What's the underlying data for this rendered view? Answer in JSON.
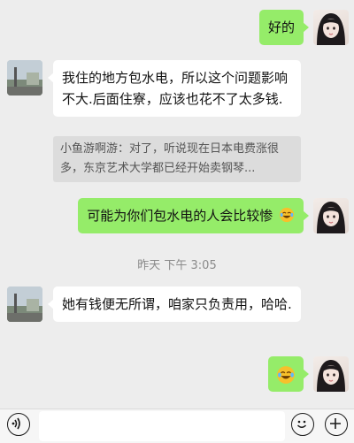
{
  "messages": {
    "m1": "好的",
    "m2": "我住的地方包水电，所以这个问题影响不大.后面住寮，应该也花不了太多钱.",
    "m2_quote": "小鱼游啊游：对了，听说现在日本电费涨很多，东京艺术大学都已经开始卖钢琴...",
    "m3": "可能为你们包水电的人会比较惨",
    "m4": "她有钱便无所谓，咱家只负责用，哈哈."
  },
  "timestamp": "昨天 下午 3:05",
  "icons": {
    "voice": "voice-icon",
    "emoji": "emoji-icon",
    "add": "add-icon",
    "reaction": "laugh-cry-emoji"
  },
  "colors": {
    "background": "#ededed",
    "green_bubble": "#95ec69",
    "white_bubble": "#ffffff",
    "quote_bg": "#dcdcdc"
  }
}
